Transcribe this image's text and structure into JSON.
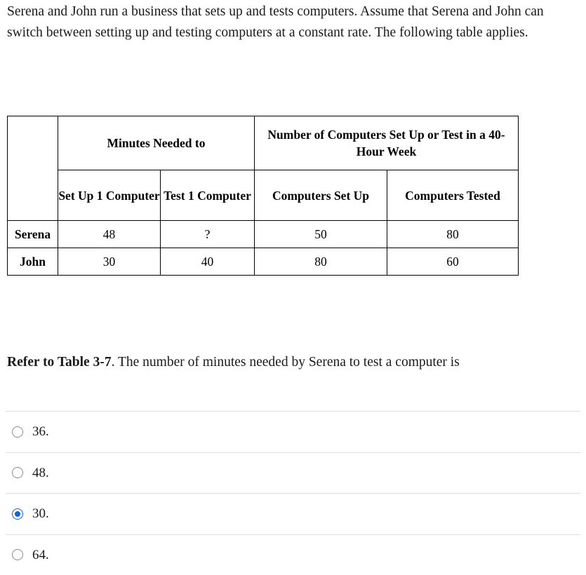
{
  "intro": {
    "text": "Serena and John run a business that sets up and tests computers. Assume that Serena and John can switch between setting up and testing computers at a constant rate. The following table applies."
  },
  "table": {
    "group_headers": {
      "corner": "",
      "minutes_needed": "Minutes Needed to",
      "number_of_computers": "Number of Computers Set Up or Test in a 40-Hour Week"
    },
    "column_headers": {
      "set_up_1_computer": "Set Up 1 Computer",
      "test_1_computer": "Test 1 Computer",
      "computers_set_up": "Computers Set Up",
      "computers_tested": "Computers Tested"
    },
    "rows": [
      {
        "name": "Serena",
        "set_up_1_computer": "48",
        "test_1_computer": "?",
        "computers_set_up": "50",
        "computers_tested": "80"
      },
      {
        "name": "John",
        "set_up_1_computer": "30",
        "test_1_computer": "40",
        "computers_set_up": "80",
        "computers_tested": "60"
      }
    ]
  },
  "question": {
    "reference": "Refer to Table 3-7",
    "body": ". The number of minutes needed by Serena to test a computer is"
  },
  "options": [
    {
      "label": "36.",
      "selected": false
    },
    {
      "label": "48.",
      "selected": false
    },
    {
      "label": "30.",
      "selected": true
    },
    {
      "label": "64.",
      "selected": false
    }
  ],
  "colors": {
    "selected_radio": "#0b68d8",
    "unselected_radio": "#8b8b8b",
    "divider": "#dddddd",
    "table_border": "#000000",
    "text": "#1a1a1a"
  }
}
